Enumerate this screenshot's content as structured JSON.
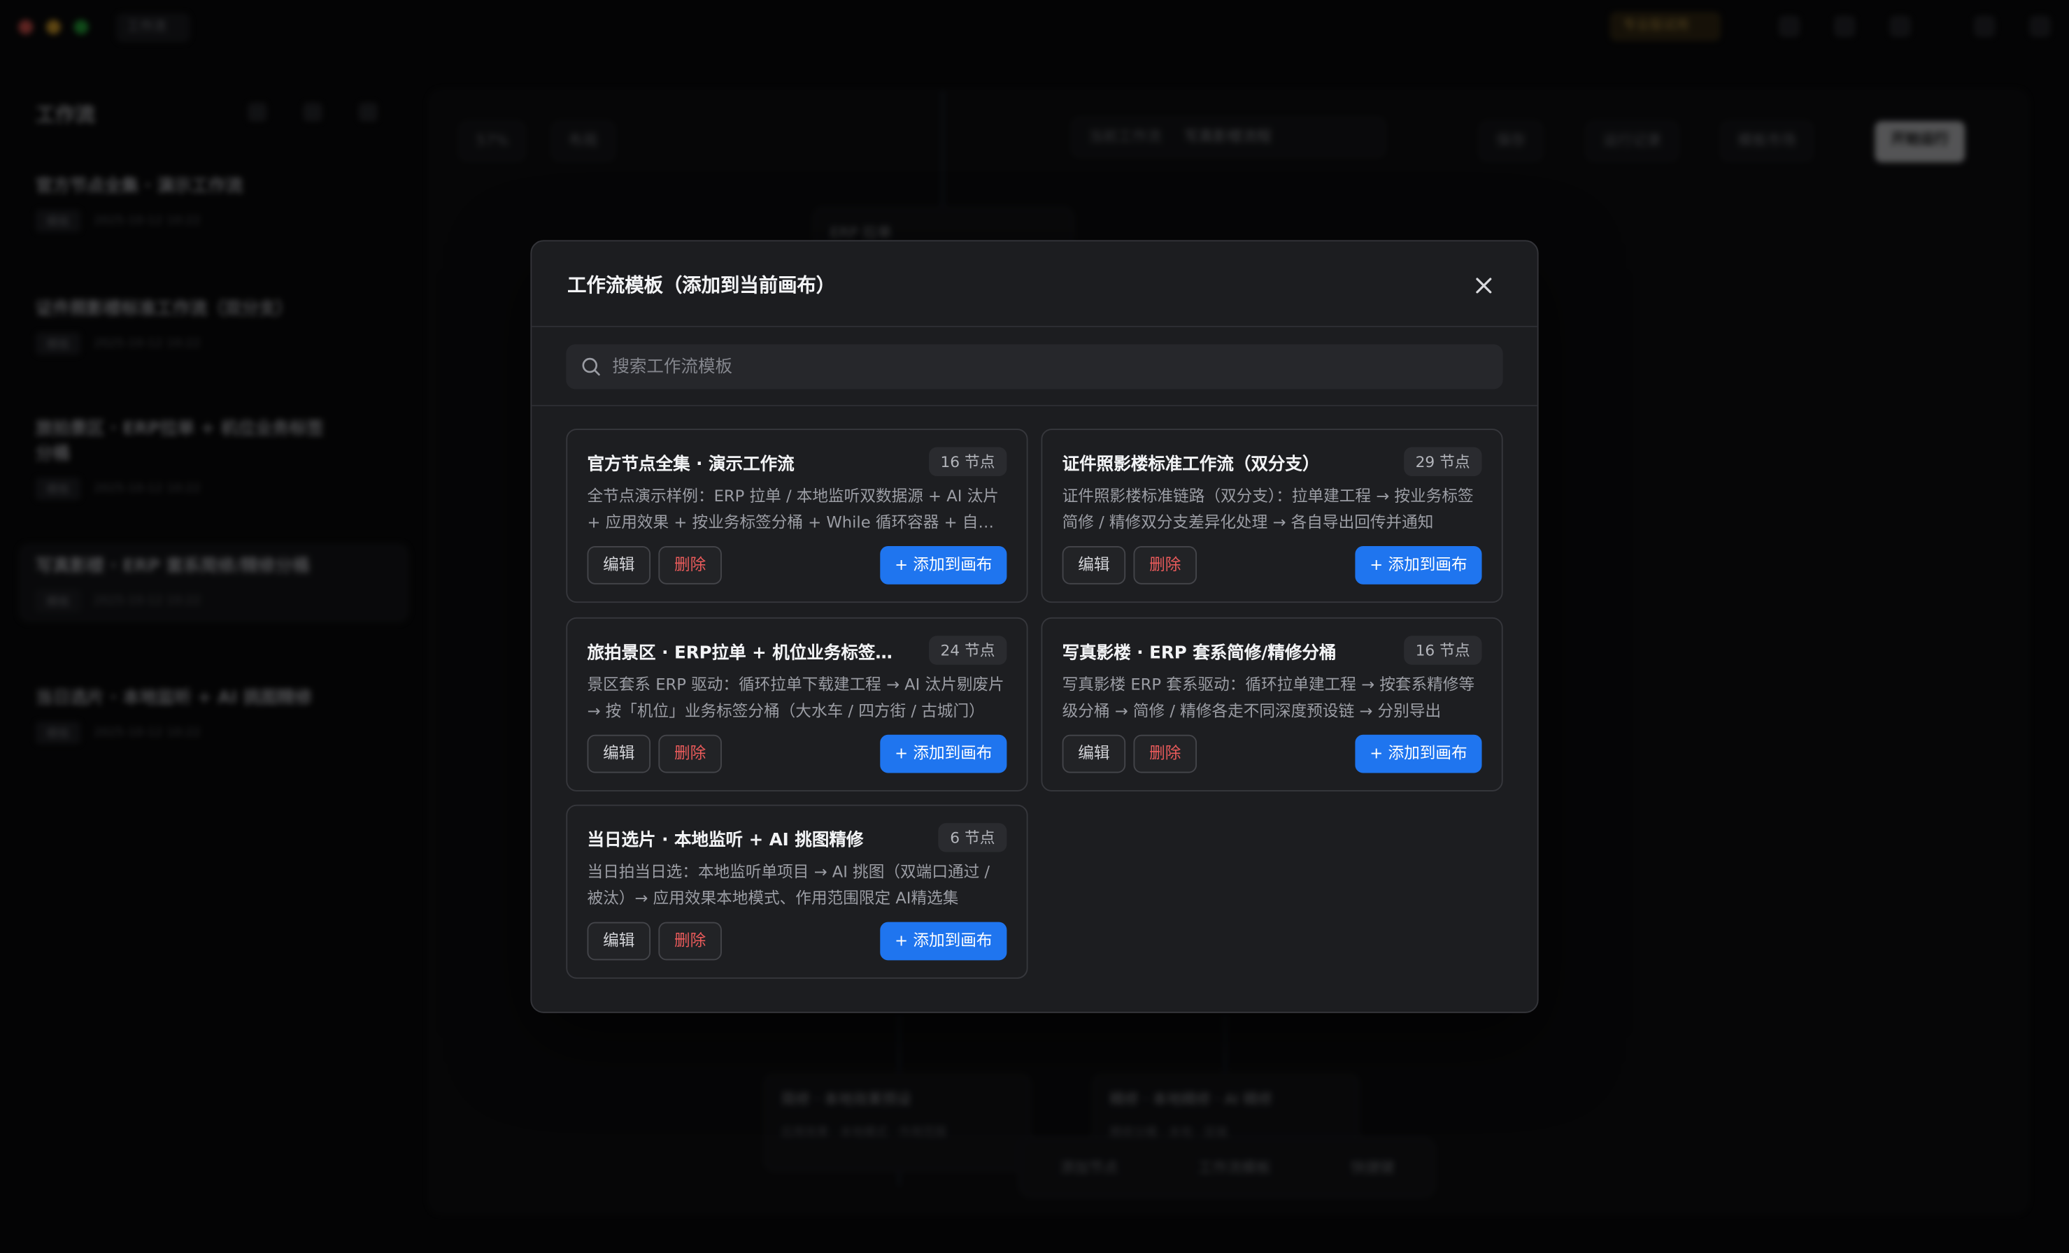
{
  "titlebar": {
    "app_chip": "工作流",
    "trial_label": "专业版试用",
    "window_dots": [
      "#ff5f57",
      "#febc2e",
      "#28c840"
    ]
  },
  "sidebar": {
    "title": "工作流",
    "workflows": [
      {
        "name": "官方节点全集 · 演示工作流",
        "tag": "模板",
        "date": "2025-10-12 10:22"
      },
      {
        "name": "证件照影楼标准工作流（双分支）",
        "tag": "模板",
        "date": "2025-10-12 10:22"
      },
      {
        "name": "旅拍景区 · ERP拉单 + 机位业务标签分桶",
        "tag": "模板",
        "date": "2025-10-12 10:22"
      },
      {
        "name": "写真影楼 · ERP 套系简修/精修分桶",
        "tag": "模板",
        "date": "2025-10-12 10:22"
      },
      {
        "name": "当日选片 · 本地监听 + AI 挑图精修",
        "tag": "模板",
        "date": "2025-10-12 10:22"
      }
    ]
  },
  "canvas": {
    "zoom": "57%",
    "layout_label": "布局",
    "workflow_select_label": "当前工作流",
    "workflow_select_value": "写真影楼流程",
    "actions": [
      "保存",
      "运行记录",
      "模板市场"
    ],
    "run_label": "开始运行",
    "nodes": [
      {
        "title": "ERP 拉单",
        "sub": ""
      },
      {
        "title": "简修 · 本地效果预设",
        "sub": "应用效果 · 本地模式 · 作用范围"
      },
      {
        "title": "精修 · 本地精修 · AI 精修",
        "sub": "精修分桶 · 本地 · 双端"
      }
    ],
    "toolbar": [
      "添加节点",
      "工作流模板",
      "快捷键"
    ]
  },
  "modal": {
    "title": "工作流模板（添加到当前画布）",
    "search_placeholder": "搜索工作流模板",
    "edit_label": "编辑",
    "delete_label": "删除",
    "add_label": "+ 添加到画布",
    "templates": [
      {
        "name": "官方节点全集 · 演示工作流",
        "nodes": "16 节点",
        "desc": "全节点演示样例：ERP 拉单 / 本地监听双数据源 + AI 汰片 + 应用效果 + 按业务标签分桶 + While 循环容器 + 自定义脚本节点"
      },
      {
        "name": "证件照影楼标准工作流（双分支）",
        "nodes": "29 节点",
        "desc": "证件照影楼标准链路（双分支）：拉单建工程 → 按业务标签简修 / 精修双分支差异化处理 → 各自导出回传并通知"
      },
      {
        "name": "旅拍景区 · ERP拉单 + 机位业务标签分桶",
        "nodes": "24 节点",
        "desc": "景区套系 ERP 驱动：循环拉单下载建工程 → AI 汰片剔废片 → 按「机位」业务标签分桶（大水车 / 四方街 / 古城门）"
      },
      {
        "name": "写真影楼 · ERP 套系简修/精修分桶",
        "nodes": "16 节点",
        "desc": "写真影楼 ERP 套系驱动：循环拉单建工程 → 按套系精修等级分桶 → 简修 / 精修各走不同深度预设链 → 分别导出"
      },
      {
        "name": "当日选片 · 本地监听 + AI 挑图精修",
        "nodes": "6 节点",
        "desc": "当日拍当日选：本地监听单项目 → AI 挑图（双端口通过 / 被汰）→ 应用效果本地模式、作用范围限定 AI精选集"
      }
    ]
  },
  "colors": {
    "accent": "#1f75ef",
    "danger": "#ea5b5b",
    "modal_bg": "#1c1d20",
    "card_border": "#36373c"
  }
}
